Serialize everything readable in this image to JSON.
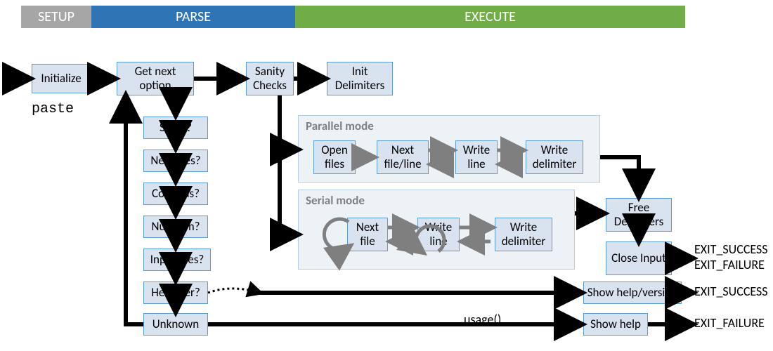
{
  "stages": {
    "setup": "SETUP",
    "parse": "PARSE",
    "execute": "EXECUTE"
  },
  "cmd": "paste",
  "boxes": {
    "initialize": "Initialize",
    "get_next_option": "Get next option",
    "sanity_checks": "Sanity Checks",
    "init_delimiters": "Init Delimiters",
    "serial_q": "Serial?",
    "newlines_q": "Newlines?",
    "columns_q": "Columns?",
    "nullterm_q": "Nullterm?",
    "input_files_q": "Input files?",
    "help_ver_q": "Help/Ver?",
    "unknown": "Unknown",
    "open_files": "Open files",
    "next_file_line": "Next file/line",
    "write_line_p": "Write line",
    "write_delimiter_p": "Write delimiter",
    "next_file": "Next file",
    "write_line_s": "Write line",
    "write_delimiter_s": "Write delimiter",
    "free_delimiters": "Free Delimiters",
    "close_input": "Close Input",
    "show_help_version": "Show help/version",
    "show_help": "Show help"
  },
  "mode_titles": {
    "parallel": "Parallel mode",
    "serial": "Serial mode"
  },
  "labels": {
    "usage": "usage()",
    "exit_success": "EXIT_SUCCESS",
    "exit_failure": "EXIT_FAILURE"
  }
}
